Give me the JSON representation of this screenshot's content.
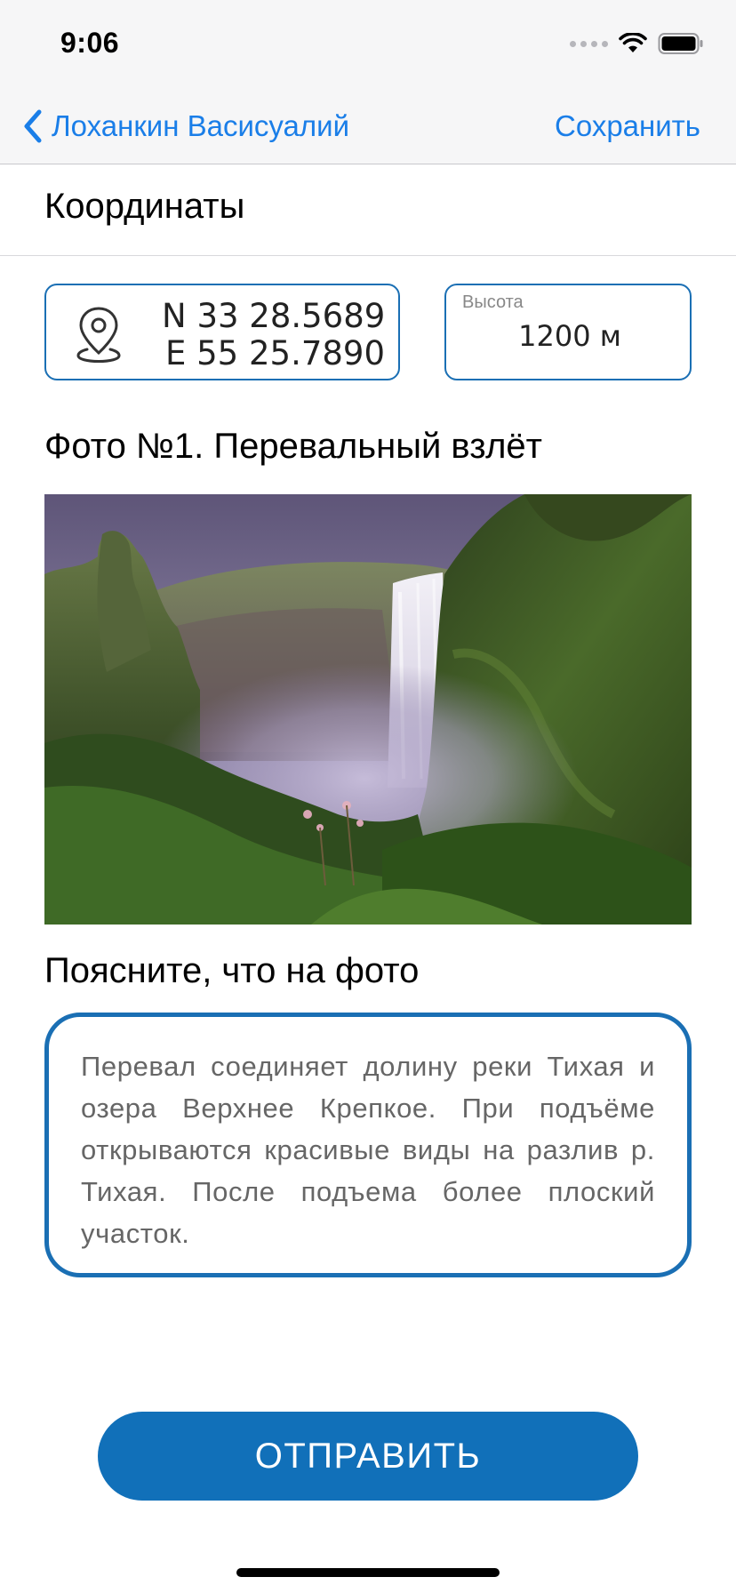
{
  "status_bar": {
    "time": "9:06",
    "icons": [
      "signal-icon",
      "wifi-icon",
      "battery-icon"
    ]
  },
  "nav": {
    "back_label": "Лоханкин Васисуалий",
    "save_label": "Сохранить",
    "accent_color": "#1a7ee8"
  },
  "section": {
    "title": "Координаты"
  },
  "coordinates": {
    "latitude": "N 33 28.5689",
    "longitude": "E 55 25.7890",
    "icon": "map-pin-icon",
    "border_color": "#1a6fb4"
  },
  "height": {
    "label": "Высота",
    "value": "1200 м"
  },
  "photo": {
    "title": "Фото №1. Перевальный взлёт",
    "subject": "waterfall-photo"
  },
  "explanation": {
    "title": "Поясните, что на фото",
    "text": "Перевал соединяет долину реки Тихая и озера Верхнее Крепкое. При подъёме открываются красивые виды на разлив р. Тихая. После подъема более плоский участок."
  },
  "actions": {
    "send_label": "ОТПРАВИТЬ",
    "button_color": "#1170b9"
  }
}
